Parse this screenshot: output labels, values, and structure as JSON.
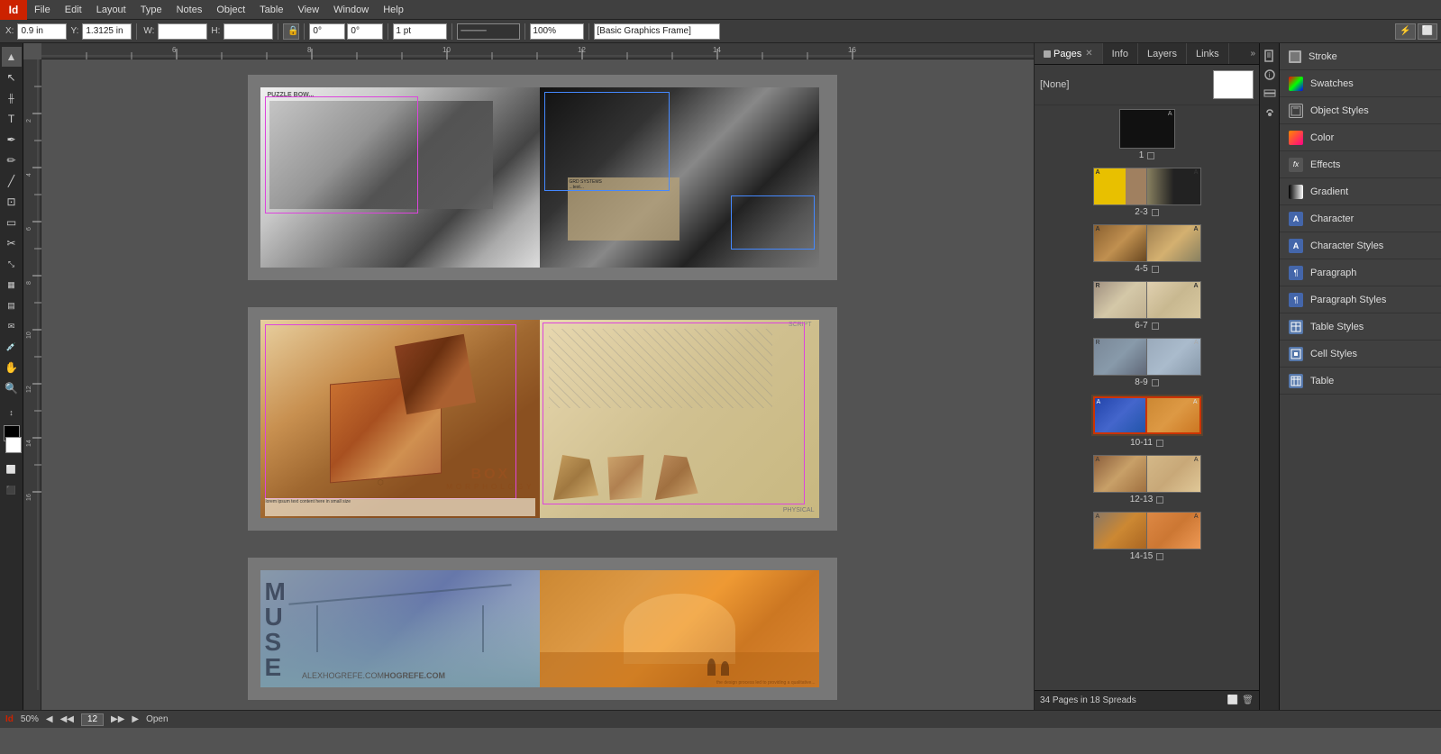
{
  "app": {
    "title": "Adobe InDesign",
    "icon_label": "Id"
  },
  "menu": {
    "items": [
      "File",
      "Edit",
      "Layout",
      "Type",
      "Notes",
      "Object",
      "Table",
      "View",
      "Window",
      "Help"
    ]
  },
  "toolbar_top": {
    "x_label": "X:",
    "x_value": "0.9 in",
    "y_label": "Y:",
    "y_value": "1.3125 in",
    "w_label": "W:",
    "h_label": "H:",
    "stroke_weight": "1 pt",
    "zoom_value": "100%",
    "frame_label": "[Basic Graphics Frame]"
  },
  "tools": [
    "▲",
    "↖",
    "↕",
    "T",
    "✏",
    "✂",
    "⬡",
    "🔍",
    "🖐",
    "↺",
    "▭",
    "⬤",
    "⬜",
    "📐",
    "🔗",
    "✂",
    "⚙",
    "🖊",
    "🔳",
    "🔲",
    "◎",
    "🔲",
    "✦"
  ],
  "pages_panel": {
    "tabs": [
      {
        "label": "Pages",
        "active": true
      },
      {
        "label": "Info"
      },
      {
        "label": "Layers"
      },
      {
        "label": "Links"
      }
    ],
    "none_label": "[None]",
    "spreads": [
      {
        "pages": [
          "1"
        ],
        "label": "1",
        "thumb_class": "thumb-content-1"
      },
      {
        "pages": [
          "2",
          "3"
        ],
        "label": "2-3",
        "thumb_class": "thumb-content-2-3"
      },
      {
        "pages": [
          "4",
          "5"
        ],
        "label": "4-5",
        "thumb_class": "thumb-content-4-5"
      },
      {
        "pages": [
          "6",
          "7"
        ],
        "label": "6-7",
        "thumb_class": "thumb-content-6-7"
      },
      {
        "pages": [
          "8",
          "9"
        ],
        "label": "8-9",
        "thumb_class": "thumb-content-8-9"
      },
      {
        "pages": [
          "10",
          "11"
        ],
        "label": "10-11",
        "thumb_class": "thumb-content-10-11",
        "active": true
      },
      {
        "pages": [
          "12",
          "13"
        ],
        "label": "12-13",
        "thumb_class": "thumb-content-12-13"
      },
      {
        "pages": [
          "14",
          "15"
        ],
        "label": "14-15",
        "thumb_class": "thumb-content-14-15"
      }
    ],
    "footer_text": "34 Pages in 18 Spreads"
  },
  "right_styles_panel": {
    "items": [
      {
        "label": "Stroke",
        "icon": "S"
      },
      {
        "label": "Swatches",
        "icon": "◼"
      },
      {
        "label": "Object Styles",
        "icon": "□"
      },
      {
        "label": "Color",
        "icon": "C"
      },
      {
        "label": "Effects",
        "icon": "fx"
      },
      {
        "label": "Gradient",
        "icon": "G"
      },
      {
        "label": "Character",
        "icon": "A"
      },
      {
        "label": "Character Styles",
        "icon": "A"
      },
      {
        "label": "Paragraph",
        "icon": "¶"
      },
      {
        "label": "Paragraph Styles",
        "icon": "¶"
      },
      {
        "label": "Table Styles",
        "icon": "T"
      },
      {
        "label": "Cell Styles",
        "icon": "C"
      },
      {
        "label": "Table",
        "icon": "⊞"
      }
    ]
  },
  "canvas": {
    "spread1": {
      "description": "Architecture/design spread top"
    },
    "spread2": {
      "description": "Box Morphology spread",
      "left_text": "BOX",
      "left_subtext": "MORPHOLOGY"
    },
    "spread3": {
      "description": "Museum architecture spread",
      "bottom_text": "ALEXHOGREFE.COM"
    }
  },
  "status_bar": {
    "zoom_label": "50%",
    "page_indicator": "12",
    "doc_status": "Open"
  }
}
